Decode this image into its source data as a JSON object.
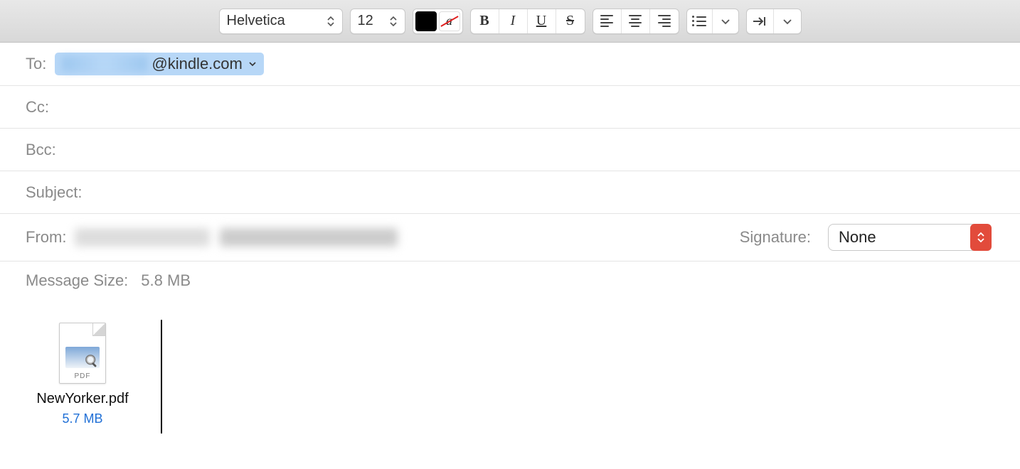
{
  "toolbar": {
    "font": "Helvetica",
    "size": "12",
    "bold": "B",
    "italic": "I",
    "underline": "U",
    "strike": "S",
    "color_swatch": "#000000"
  },
  "fields": {
    "to_label": "To:",
    "to_value": "@kindle.com",
    "cc_label": "Cc:",
    "cc_value": "",
    "bcc_label": "Bcc:",
    "bcc_value": "",
    "subject_label": "Subject:",
    "subject_value": "",
    "from_label": "From:",
    "signature_label": "Signature:",
    "signature_value": "None",
    "message_size_label": "Message Size:",
    "message_size_value": "5.8 MB"
  },
  "attachment": {
    "ext_label": "PDF",
    "filename": "NewYorker.pdf",
    "filesize": "5.7 MB"
  }
}
